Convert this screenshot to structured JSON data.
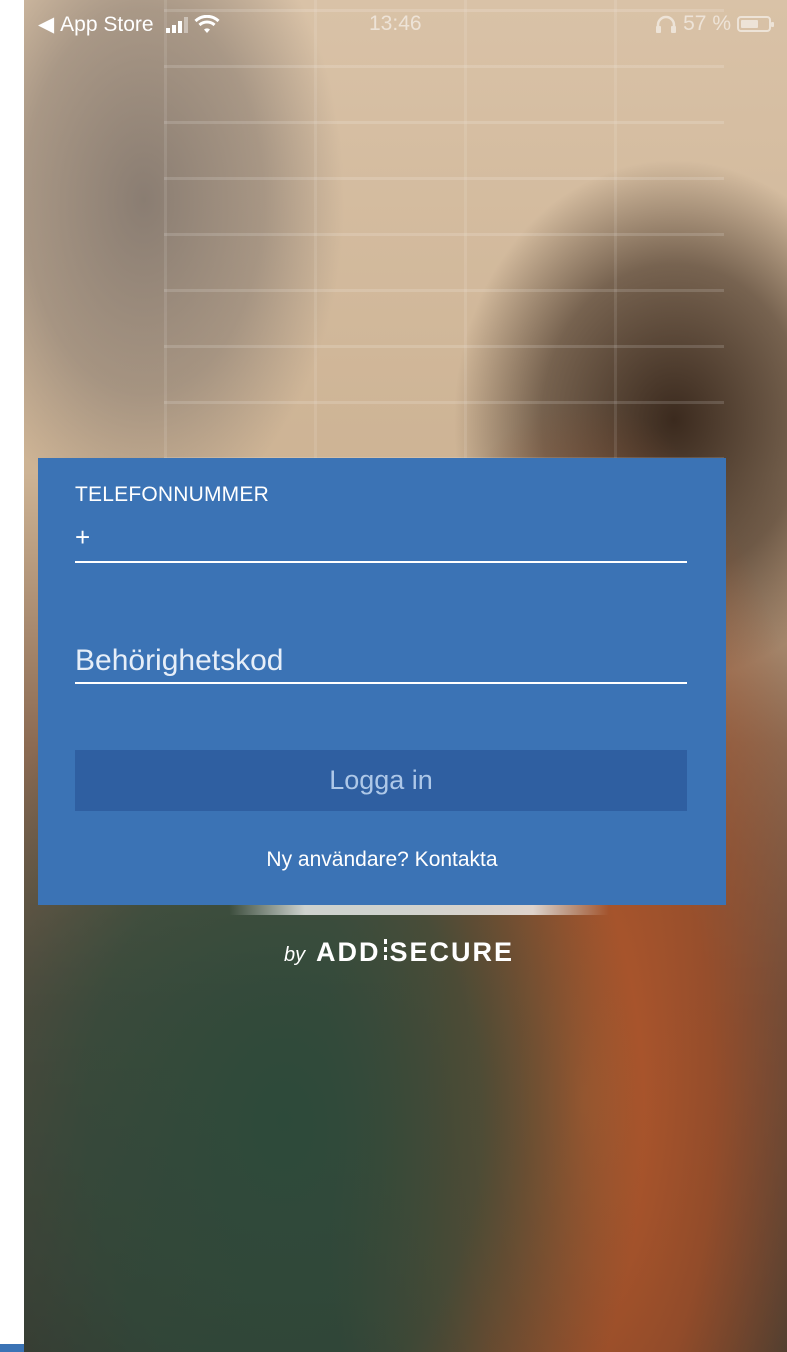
{
  "status_bar": {
    "back_app": "App Store",
    "time": "13:46",
    "battery_percent": "57 %",
    "icons": [
      "back-triangle-icon",
      "signal-icon",
      "wifi-icon",
      "headphones-icon",
      "battery-icon"
    ]
  },
  "login": {
    "phone_label": "TELEFONNUMMER",
    "phone_prefix": "+",
    "code_placeholder": "Behörighetskod",
    "login_button": "Logga in",
    "new_user_text": "Ny användare? Kontakta"
  },
  "branding": {
    "by": "by",
    "logo_left": "ADD",
    "logo_right": "SECURE"
  },
  "colors": {
    "card": "#3b73b5",
    "button": "#2f5fa1",
    "text": "#ffffff"
  }
}
